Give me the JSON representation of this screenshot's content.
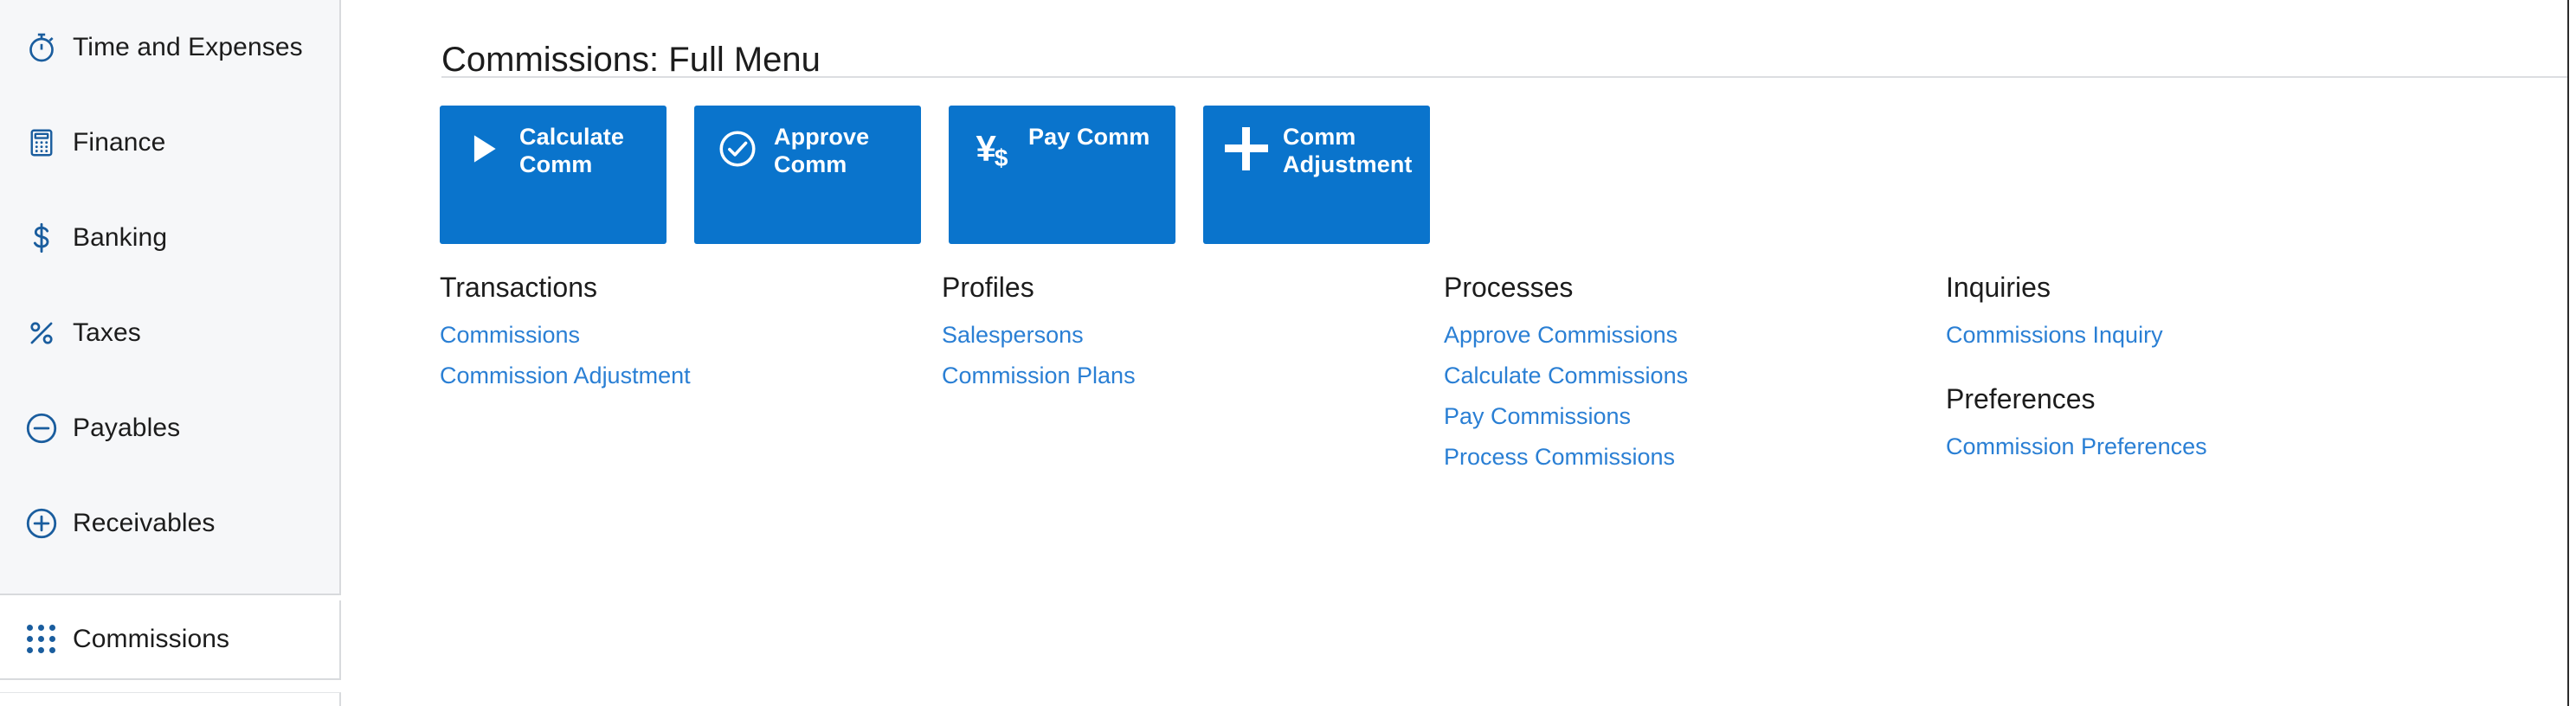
{
  "sidebar": {
    "items": [
      {
        "label": "Time and Expenses",
        "icon": "stopwatch-icon"
      },
      {
        "label": "Finance",
        "icon": "calculator-icon"
      },
      {
        "label": "Banking",
        "icon": "dollar-sign-icon"
      },
      {
        "label": "Taxes",
        "icon": "percent-icon"
      },
      {
        "label": "Payables",
        "icon": "minus-circle-icon"
      },
      {
        "label": "Receivables",
        "icon": "plus-circle-icon"
      }
    ],
    "active_item": {
      "label": "Commissions",
      "icon": "dot-grid-icon"
    }
  },
  "header": {
    "title": "Commissions: Full Menu"
  },
  "tiles": [
    {
      "label": "Calculate Comm",
      "icon": "play-triangle-icon"
    },
    {
      "label": "Approve Comm",
      "icon": "check-circle-icon"
    },
    {
      "label": "Pay Comm",
      "icon": "yen-dollar-icon"
    },
    {
      "label": "Comm Adjustment",
      "icon": "plus-icon"
    }
  ],
  "columns": [
    {
      "heading": "Transactions",
      "links": [
        "Commissions",
        "Commission Adjustment"
      ]
    },
    {
      "heading": "Profiles",
      "links": [
        "Salespersons",
        "Commission Plans"
      ]
    },
    {
      "heading": "Processes",
      "links": [
        "Approve Commissions",
        "Calculate Commissions",
        "Pay Commissions",
        "Process Commissions"
      ]
    },
    {
      "heading": "Inquiries",
      "links": [
        "Commissions Inquiry"
      ],
      "heading2": "Preferences",
      "links2": [
        "Commission Preferences"
      ]
    }
  ],
  "colors": {
    "tile_blue": "#0a74cc",
    "link_blue": "#2a7fd4",
    "icon_blue": "#1a5d9e",
    "sidebar_bg": "#f6f7f9",
    "text": "#1c1c1c"
  }
}
